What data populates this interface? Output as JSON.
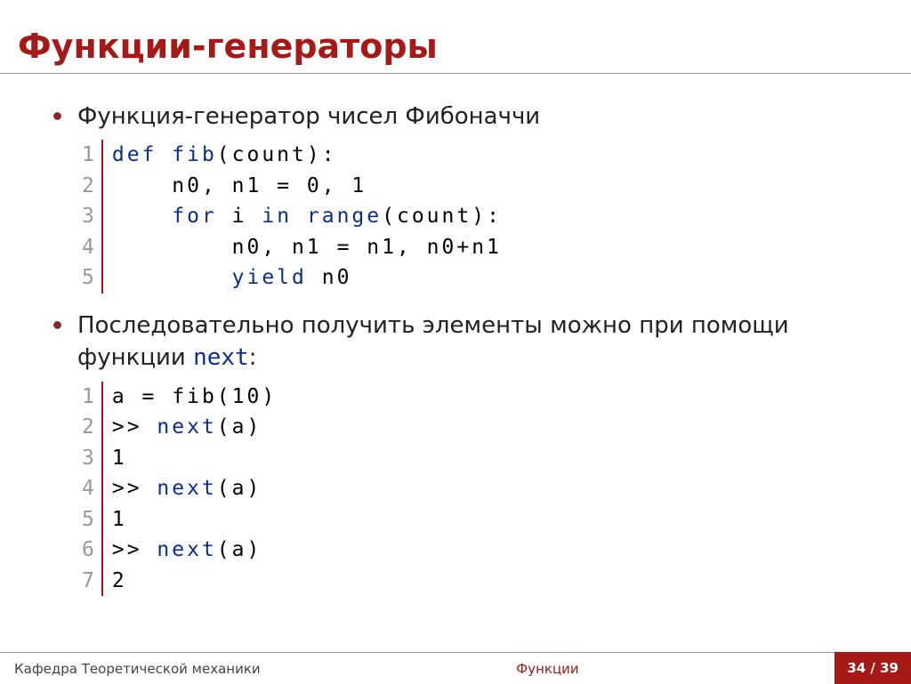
{
  "title": "Функции-генераторы",
  "items": [
    {
      "text": "Функция-генератор чисел Фибоначчи"
    },
    {
      "text_before": "Последовательно получить элементы можно при помощи функции ",
      "code": "next",
      "text_after": ":"
    }
  ],
  "code1": {
    "numbers": [
      "1",
      "2",
      "3",
      "4",
      "5"
    ],
    "lines": [
      [
        {
          "t": "def ",
          "c": "kw"
        },
        {
          "t": "fib",
          "c": "fn"
        },
        {
          "t": "(count):",
          "c": "var"
        }
      ],
      [
        {
          "t": "    n0, n1 = 0, 1",
          "c": "var"
        }
      ],
      [
        {
          "t": "    ",
          "c": "var"
        },
        {
          "t": "for ",
          "c": "kw"
        },
        {
          "t": "i ",
          "c": "var"
        },
        {
          "t": "in ",
          "c": "kw"
        },
        {
          "t": "range",
          "c": "fn"
        },
        {
          "t": "(count):",
          "c": "var"
        }
      ],
      [
        {
          "t": "        n0, n1 = n1, n0+n1",
          "c": "var"
        }
      ],
      [
        {
          "t": "        ",
          "c": "var"
        },
        {
          "t": "yield ",
          "c": "kw"
        },
        {
          "t": "n0",
          "c": "var"
        }
      ]
    ]
  },
  "code2": {
    "numbers": [
      "1",
      "2",
      "3",
      "4",
      "5",
      "6",
      "7"
    ],
    "lines": [
      [
        {
          "t": "a = fib(10)",
          "c": "var"
        }
      ],
      [
        {
          "t": ">> ",
          "c": "var"
        },
        {
          "t": "next",
          "c": "fn"
        },
        {
          "t": "(a)",
          "c": "var"
        }
      ],
      [
        {
          "t": "1",
          "c": "var"
        }
      ],
      [
        {
          "t": ">> ",
          "c": "var"
        },
        {
          "t": "next",
          "c": "fn"
        },
        {
          "t": "(a)",
          "c": "var"
        }
      ],
      [
        {
          "t": "1",
          "c": "var"
        }
      ],
      [
        {
          "t": ">> ",
          "c": "var"
        },
        {
          "t": "next",
          "c": "fn"
        },
        {
          "t": "(a)",
          "c": "var"
        }
      ],
      [
        {
          "t": "2",
          "c": "var"
        }
      ]
    ]
  },
  "footer": {
    "left": "Кафедра Теоретической механики",
    "center": "Функции",
    "right": "34 / 39"
  }
}
